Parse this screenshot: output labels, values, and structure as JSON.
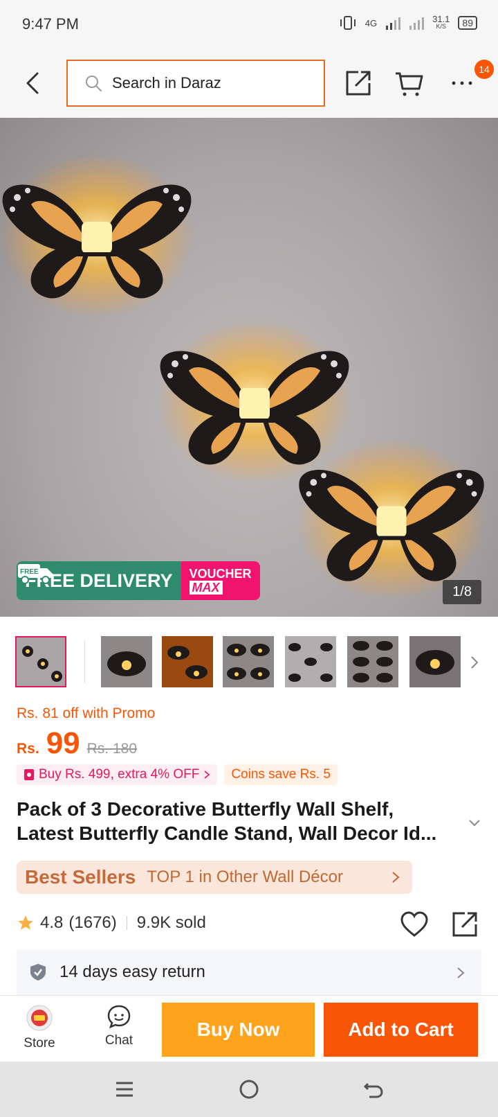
{
  "status_bar": {
    "time": "9:47 PM",
    "network": "4G",
    "speed": "31.1",
    "speed_unit": "K/S",
    "battery": "89"
  },
  "header": {
    "search_placeholder": "Search in Daraz",
    "more_badge": "14"
  },
  "gallery": {
    "counter": "1/8",
    "free_delivery": "FREE DELIVERY",
    "free_tag": "FREE",
    "voucher": "VOUCHER",
    "voucher_max": "MAX",
    "thumbnail_count": 7
  },
  "price": {
    "promo_off": "Rs. 81 off with Promo",
    "currency": "Rs.",
    "current": "99",
    "original": "Rs. 180"
  },
  "tags": {
    "bundle": "Buy Rs. 499, extra 4% OFF",
    "coins": "Coins save Rs. 5"
  },
  "product": {
    "title_line1": "Pack of 3 Decorative Butterfly Wall Shelf,",
    "title_line2": "Latest Butterfly Candle Stand, Wall Decor Id..."
  },
  "bestseller": {
    "logo": "Best Sellers",
    "text": "TOP 1 in Other Wall Décor"
  },
  "rating": {
    "score": "4.8",
    "count": "(1676)",
    "sold": "9.9K sold"
  },
  "return_policy": {
    "text": "14 days easy return"
  },
  "action_bar": {
    "store_label": "Store",
    "chat_label": "Chat",
    "buy_now": "Buy Now",
    "add_to_cart": "Add to Cart"
  },
  "colors": {
    "brand_orange": "#f85606",
    "buy_now": "#fea31b",
    "search_border": "#e96a1f",
    "voucher_pink": "#f0146e",
    "free_green": "#2e8b6e"
  }
}
